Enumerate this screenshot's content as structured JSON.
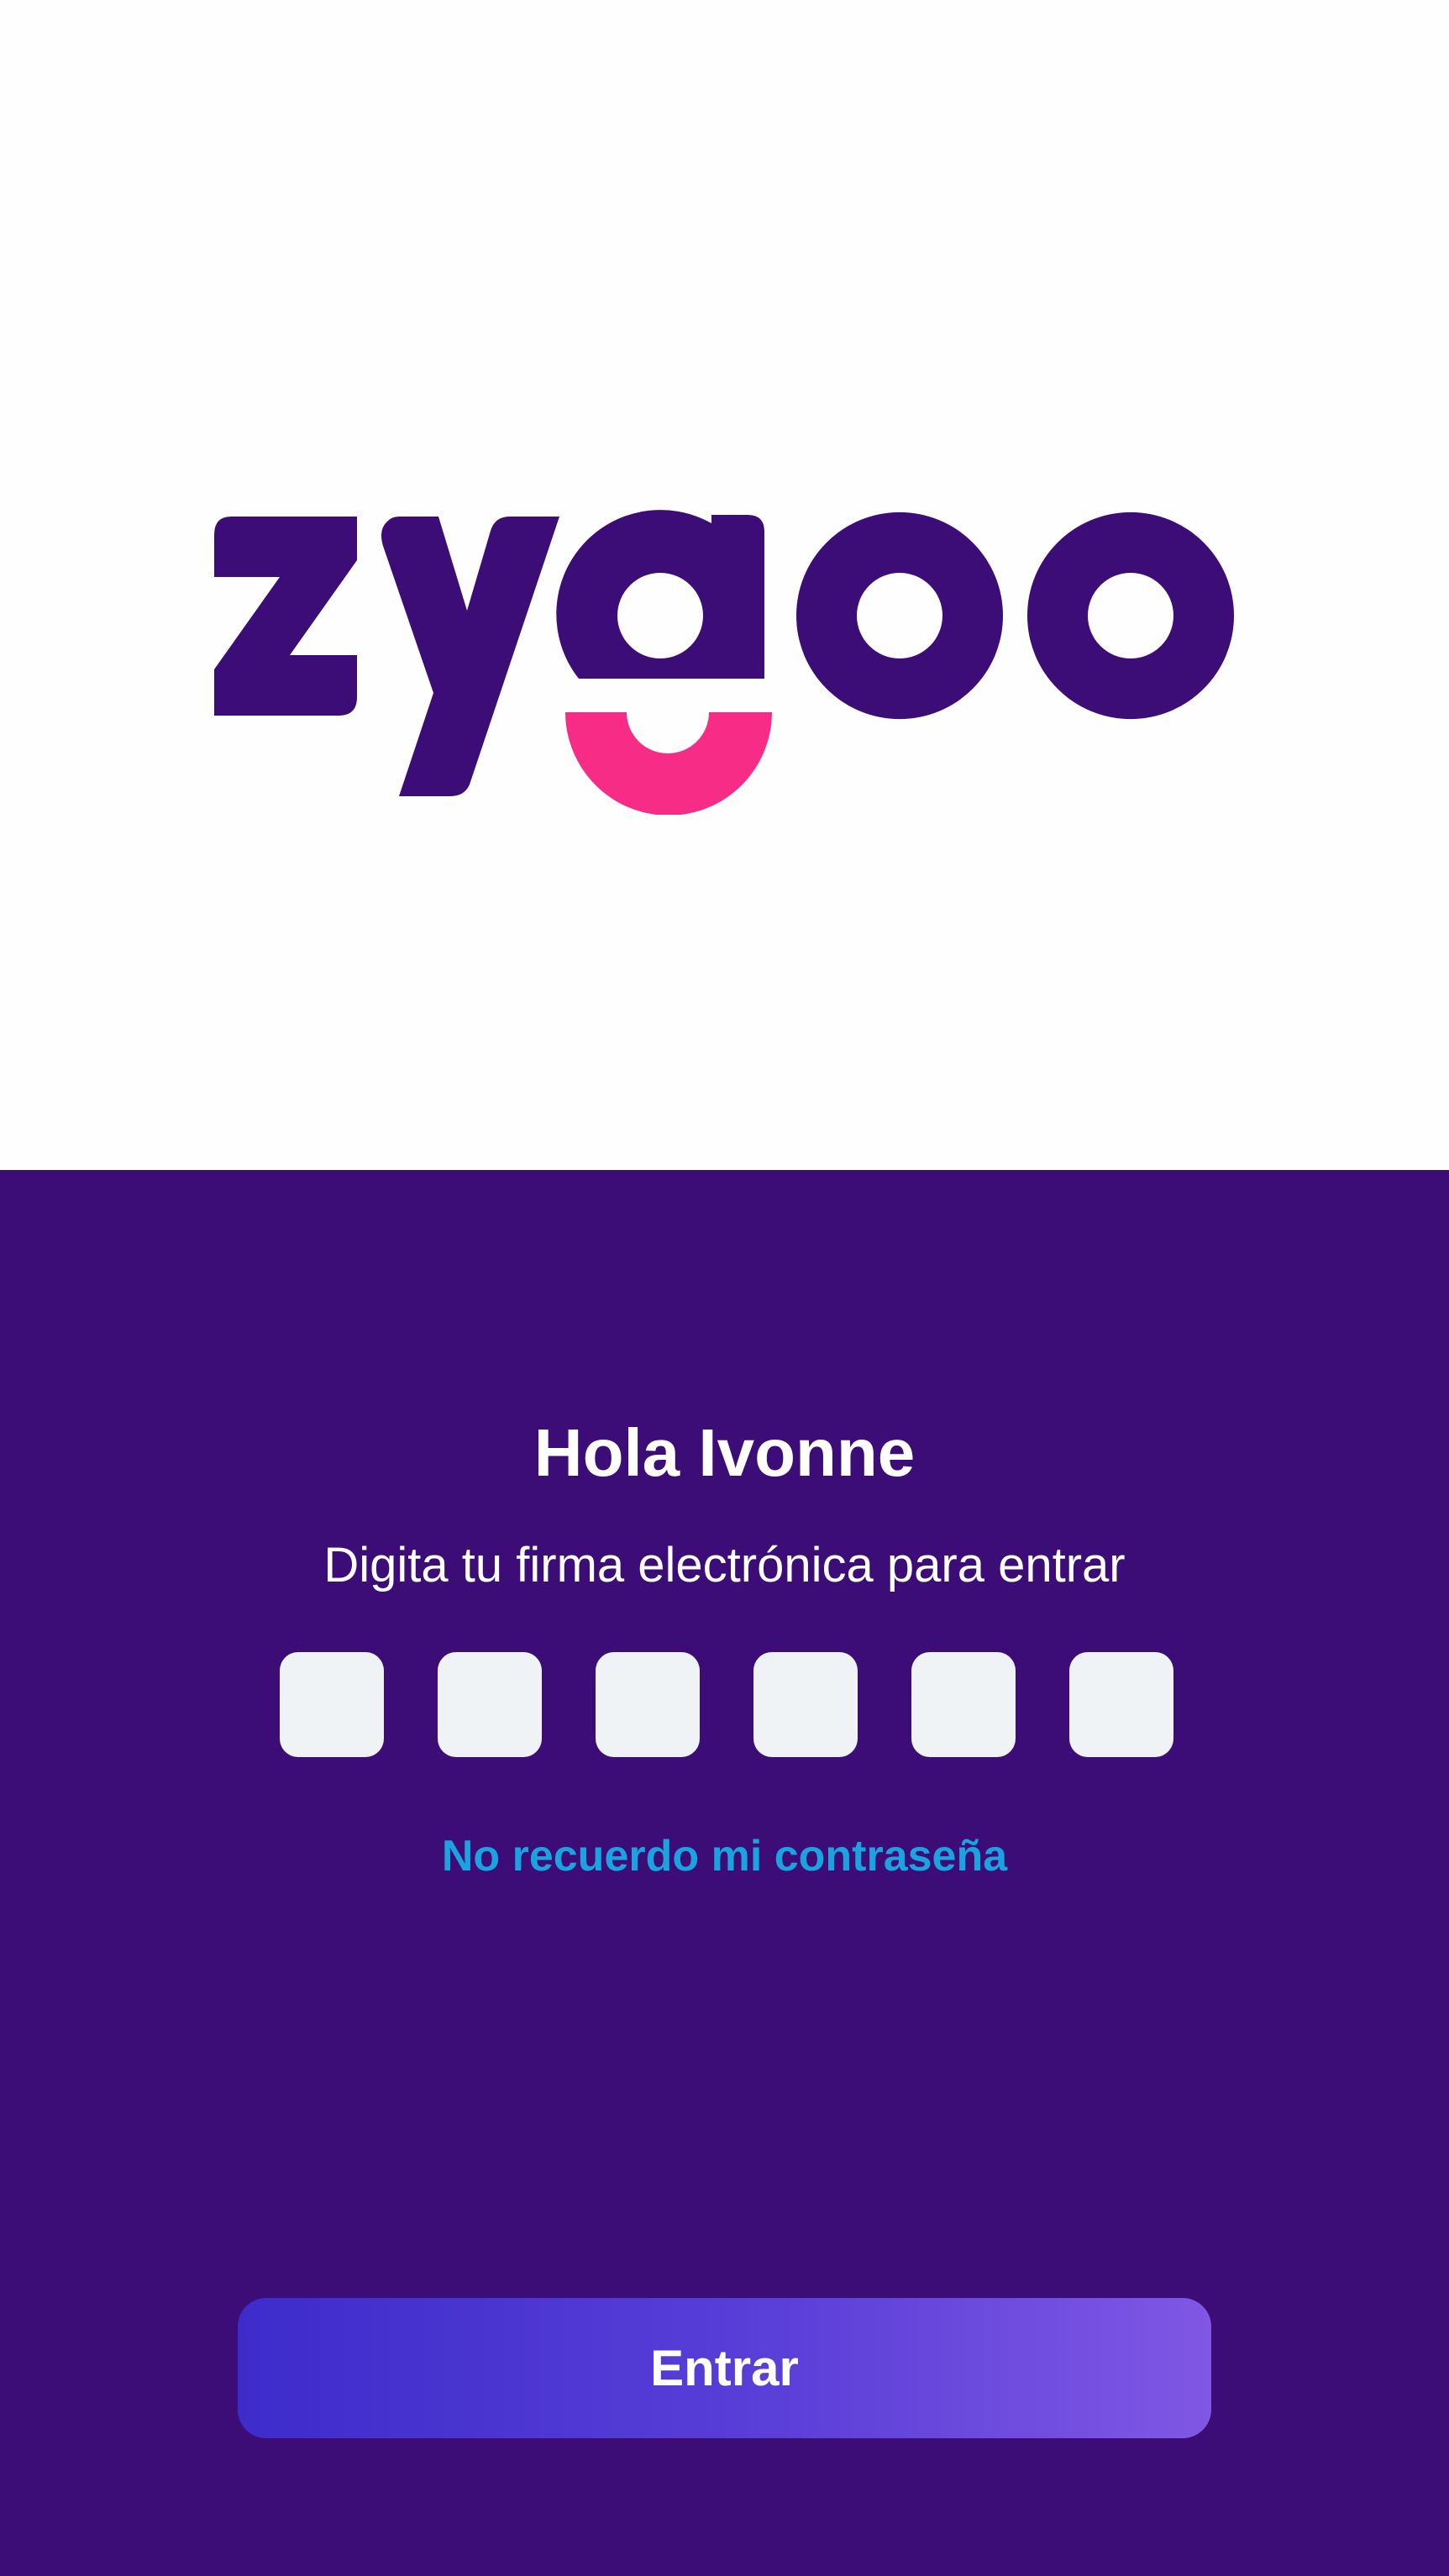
{
  "brand": {
    "name": "zygoo",
    "colors": {
      "primary": "#3c0d76",
      "accent": "#f72c87",
      "link": "#1ba3e0",
      "pin_box": "#eff3f5",
      "button_start": "#3d2ccb",
      "button_end": "#8057e4",
      "text_on_dark": "#ffffff"
    }
  },
  "login": {
    "greeting": "Hola Ivonne",
    "instruction": "Digita tu firma electrónica para entrar",
    "pin_fields": [
      "",
      "",
      "",
      "",
      "",
      ""
    ],
    "forgot_password": "No recuerdo mi contraseña",
    "submit_label": "Entrar"
  }
}
